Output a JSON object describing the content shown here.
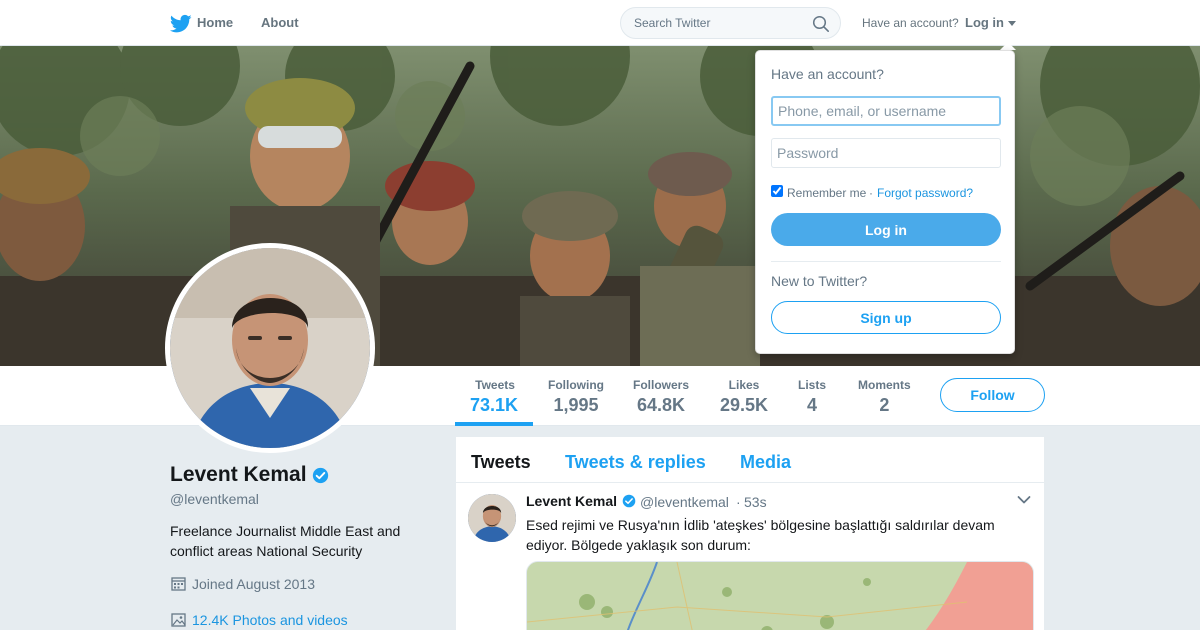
{
  "nav": {
    "home": "Home",
    "about": "About",
    "search_placeholder": "Search Twitter",
    "have_account": "Have an account?",
    "login": "Log in"
  },
  "profile": {
    "name": "Levent Kemal",
    "handle": "@leventkemal",
    "bio": "Freelance Journalist Middle East and conflict areas National Security",
    "joined": "Joined August 2013",
    "photos": "12.4K Photos and videos"
  },
  "stats": [
    {
      "label": "Tweets",
      "value": "73.1K"
    },
    {
      "label": "Following",
      "value": "1,995"
    },
    {
      "label": "Followers",
      "value": "64.8K"
    },
    {
      "label": "Likes",
      "value": "29.5K"
    },
    {
      "label": "Lists",
      "value": "4"
    },
    {
      "label": "Moments",
      "value": "2"
    }
  ],
  "follow_label": "Follow",
  "timeline": {
    "tabs": [
      "Tweets",
      "Tweets & replies",
      "Media"
    ],
    "tweet": {
      "name": "Levent Kemal",
      "handle": "@leventkemal",
      "dot": "·",
      "time": "53s",
      "text": "Esed rejimi ve Rusya'nın İdlib 'ateşkes' bölgesine başlattığı saldırılar devam ediyor. Bölgede yaklaşık son durum:"
    }
  },
  "login_dropdown": {
    "title": "Have an account?",
    "username_placeholder": "Phone, email, or username",
    "password_placeholder": "Password",
    "remember": "Remember me",
    "dot": "·",
    "forgot": "Forgot password?",
    "login_button": "Log in",
    "new_to_twitter": "New to Twitter?",
    "signup_button": "Sign up"
  },
  "colors": {
    "accent": "#1da1f2",
    "login_button": "#4aaaea",
    "page_bg": "#e6ecf0"
  }
}
